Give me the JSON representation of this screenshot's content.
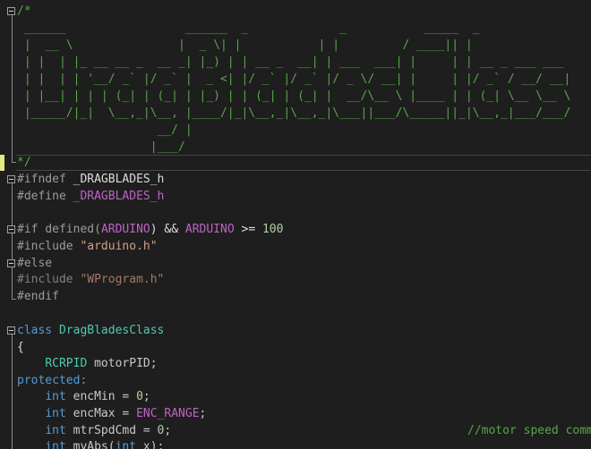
{
  "colors": {
    "background": "#1e1e1e",
    "comment": "#57a64a",
    "keyword": "#569cd6",
    "macro": "#bd63c5",
    "string": "#d69d85",
    "number": "#b5cea8",
    "class_name": "#4ec9b0",
    "preprocessor": "#9b9b9b",
    "change_marker": "#e5e58a"
  },
  "icons": {
    "fold": "collapse-box-icon"
  },
  "header_comment": {
    "open": "/*",
    "ascii_art": [
      " ______                 ______  _             _           _____  _",
      " |  __ \\               |  _ \\| |           | |         / ____|| |",
      " | |  | |_ __ __ _  __ _| |_) | | __ _  __| | ___  ___| |     | | __ _ ___ ___",
      " | |  | | '__/ _` |/ _` |  _ <| |/ _` |/ _` |/ _ \\/ __| |     | |/ _` / __/ __|",
      " | |__| | | | (_| | (_| | |_) | | (_| | (_| |  __/\\__ \\ |____ | | (_| \\__ \\__ \\",
      " |_____/|_|  \\__,_|\\__, |____/|_|\\__,_|\\__,_|\\___||___/\\_____||_|\\__,_|___/___/",
      "                    __/ |",
      "                   |___/"
    ],
    "close": "*/"
  },
  "code": {
    "ifndef": {
      "directive": "#ifndef",
      "name": "_DRAGBLADES_h"
    },
    "define": {
      "directive": "#define",
      "name": "_DRAGBLADES_h"
    },
    "if_line": {
      "directive": "#if",
      "defined_kw": "defined(",
      "macro1": "ARDUINO",
      "middle": ") && ",
      "macro2": "ARDUINO",
      "op": " >= ",
      "value": "100"
    },
    "include1": {
      "directive": "#include",
      "file": "\"arduino.h\""
    },
    "else": "#else",
    "include2": {
      "directive": "#include",
      "file": "\"WProgram.h\""
    },
    "endif": "#endif",
    "class_line": {
      "keyword": "class",
      "name": "DragBladesClass"
    },
    "open_brace": "{",
    "member_pid": {
      "type": "RCRPID",
      "name": "motorPID;"
    },
    "protected_label": "protected:",
    "members": [
      {
        "type": "int",
        "rest": "encMin = ",
        "value": "0",
        "end": ";"
      },
      {
        "type": "int",
        "rest": "encMax = ",
        "value": "ENC_RANGE",
        "end": ";"
      },
      {
        "type": "int",
        "rest": "mtrSpdCmd = ",
        "value": "0",
        "end": ";"
      },
      {
        "type": "int",
        "rest": "myAbs(",
        "arg_type": "int",
        "arg": " x);"
      }
    ],
    "trailing_comment": "//motor speed comm"
  }
}
